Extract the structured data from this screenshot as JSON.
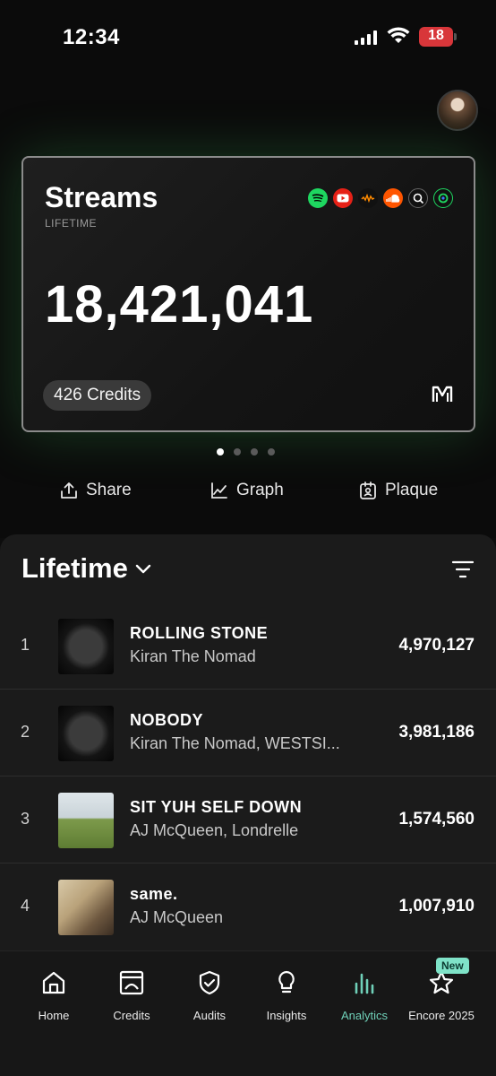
{
  "status_bar": {
    "time": "12:34",
    "battery": "18"
  },
  "card": {
    "title": "Streams",
    "subtitle": "LIFETIME",
    "value": "18,421,041",
    "credits": "426 Credits",
    "platforms": [
      "spotify-icon",
      "youtube-icon",
      "audiomack-icon",
      "soundcloud-icon",
      "search-platform-icon",
      "circle-platform-icon"
    ]
  },
  "pager": {
    "pages": 4,
    "active": 1
  },
  "actions": {
    "share": "Share",
    "graph": "Graph",
    "plaque": "Plaque"
  },
  "list": {
    "title": "Lifetime",
    "rows": [
      {
        "rank": "1",
        "title": "ROLLING STONE",
        "artist": "Kiran The Nomad",
        "streams": "4,970,127"
      },
      {
        "rank": "2",
        "title": "NOBODY",
        "artist": "Kiran The Nomad, WESTSI...",
        "streams": "3,981,186"
      },
      {
        "rank": "3",
        "title": "SIT YUH SELF DOWN",
        "artist": "AJ McQueen, Londrelle",
        "streams": "1,574,560"
      },
      {
        "rank": "4",
        "title": "same.",
        "artist": "AJ McQueen",
        "streams": "1,007,910"
      }
    ]
  },
  "tabs": {
    "home": "Home",
    "credits": "Credits",
    "audits": "Audits",
    "insights": "Insights",
    "analytics": "Analytics",
    "encore": "Encore 2025",
    "new_badge": "New"
  },
  "colors": {
    "accent": "#6fd0b8",
    "glow": "#3cc85a"
  }
}
